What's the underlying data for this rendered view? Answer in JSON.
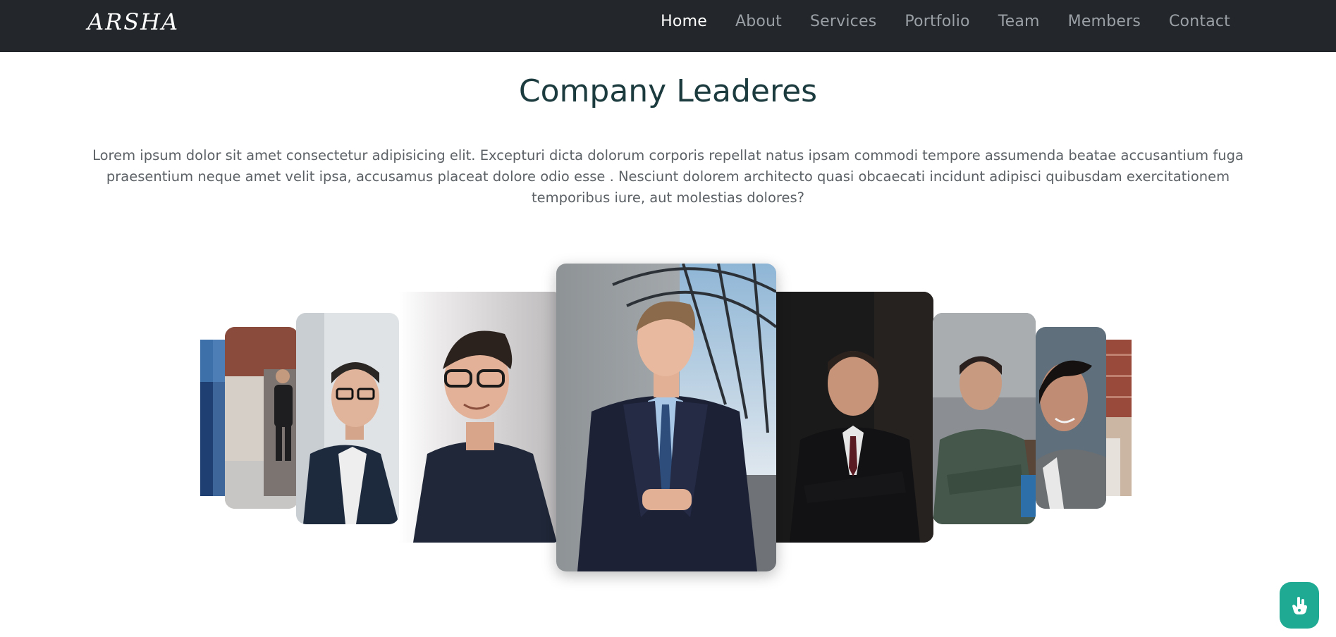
{
  "brand": {
    "logo_text": "ARSHA"
  },
  "nav": {
    "items": [
      {
        "label": "Home",
        "active": true
      },
      {
        "label": "About",
        "active": false
      },
      {
        "label": "Services",
        "active": false
      },
      {
        "label": "Portfolio",
        "active": false
      },
      {
        "label": "Team",
        "active": false
      },
      {
        "label": "Members",
        "active": false
      },
      {
        "label": "Contact",
        "active": false
      }
    ]
  },
  "section": {
    "title": "Company Leaderes",
    "description": "Lorem ipsum dolor sit amet consectetur adipisicing elit. Excepturi dicta dolorum corporis repellat natus ipsam commodi tempore assumenda beatae accusantium fuga praesentium neque amet velit ipsa, accusamus placeat dolore odio esse . Nesciunt dolorem architecto quasi obcaecati incidunt adipisci quibusdam exercitationem temporibus iure, aut molestias dolores?"
  },
  "carousel": {
    "active_index": 4,
    "slides": [
      {
        "subject": "man-blue-jacket"
      },
      {
        "subject": "man-sunglasses-street"
      },
      {
        "subject": "man-glasses-blazer"
      },
      {
        "subject": "young-man-glasses-shirt"
      },
      {
        "subject": "man-navy-suit-tie"
      },
      {
        "subject": "man-dark-suit-arms-crossed"
      },
      {
        "subject": "man-green-hoodie"
      },
      {
        "subject": "man-smiling-portrait"
      },
      {
        "subject": "man-brick-wall"
      }
    ]
  },
  "colors": {
    "header_bg": "#23272b",
    "title": "#1c3b3f",
    "body_text": "#5c6166",
    "accent": "#1fab93"
  },
  "icons": {
    "floating_button": "hand-pointer-icon"
  }
}
